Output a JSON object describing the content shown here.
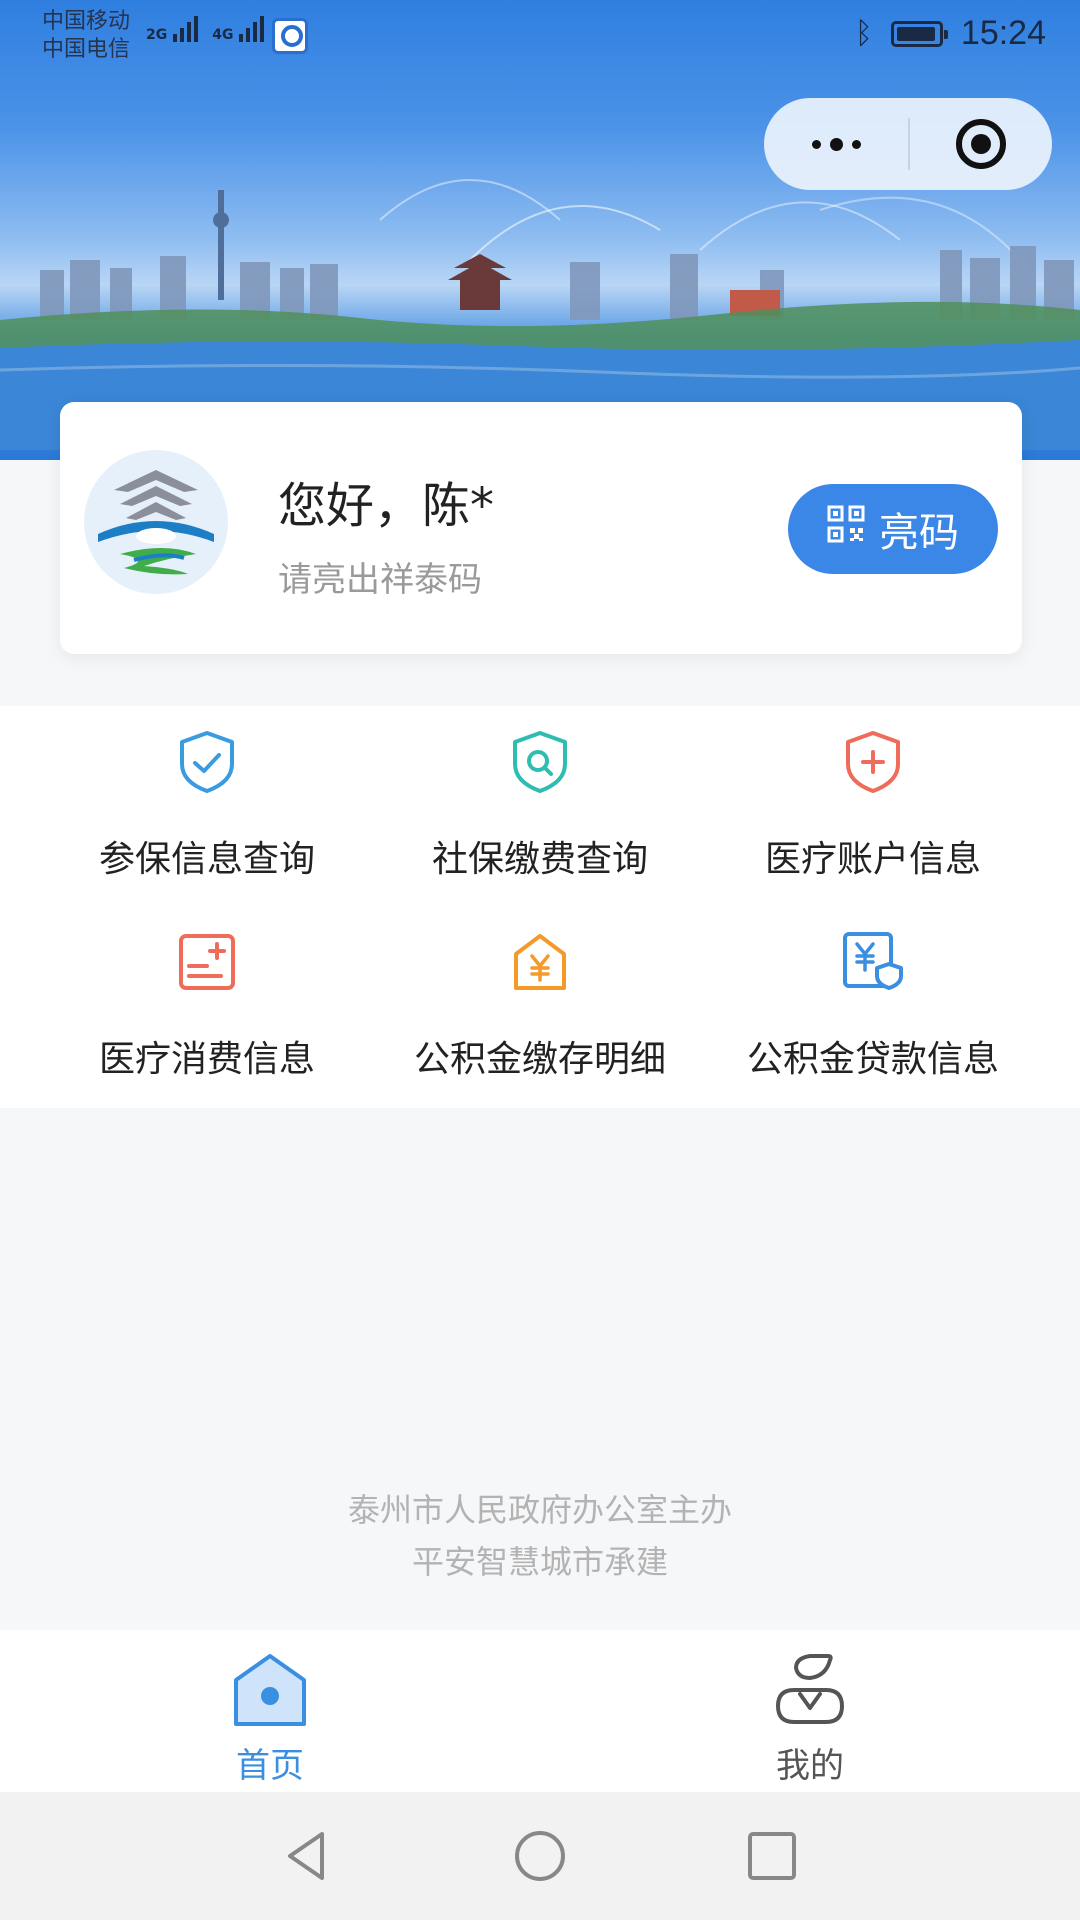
{
  "status_bar": {
    "carrier_1": "中国移动",
    "carrier_2": "中国电信",
    "net_1": "2G",
    "net_2": "4G",
    "time": "15:24"
  },
  "capsule": {
    "more_icon": "more-dots-icon",
    "close_icon": "target-close-icon"
  },
  "card": {
    "greeting": "您好，陈*",
    "subtitle": "请亮出祥泰码",
    "qr_button_label": "亮码",
    "qr_icon": "qr-code-icon"
  },
  "services": [
    {
      "label": "参保信息查询",
      "icon": "shield-check-icon",
      "color": "#3a9be0"
    },
    {
      "label": "社保缴费查询",
      "icon": "shield-search-icon",
      "color": "#2ebdb1"
    },
    {
      "label": "医疗账户信息",
      "icon": "shield-plus-icon",
      "color": "#ef6c5a"
    },
    {
      "label": "医疗消费信息",
      "icon": "medical-bill-icon",
      "color": "#ef6c5a"
    },
    {
      "label": "公积金缴存明细",
      "icon": "yuan-house-icon",
      "color": "#f39a2b"
    },
    {
      "label": "公积金贷款信息",
      "icon": "yuan-card-shield-icon",
      "color": "#3a8fe0"
    }
  ],
  "credits": {
    "line_1": "泰州市人民政府办公室主办",
    "line_2": "平安智慧城市承建"
  },
  "tabs": [
    {
      "label": "首页",
      "icon": "home-icon",
      "active": true,
      "color": "#3a8fe0"
    },
    {
      "label": "我的",
      "icon": "profile-icon",
      "active": false,
      "color": "#555555"
    }
  ]
}
